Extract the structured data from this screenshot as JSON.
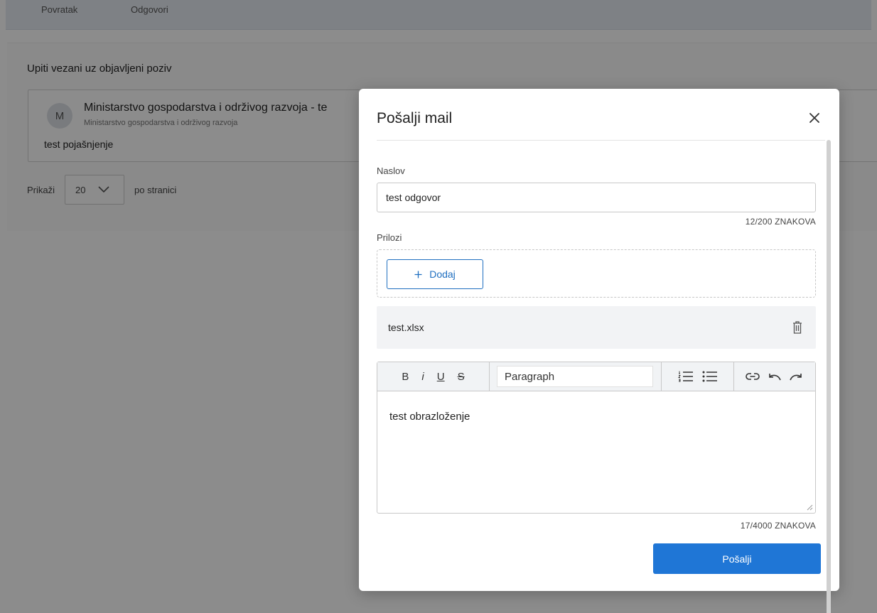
{
  "background": {
    "tabs": [
      "Povratak",
      "Odgovori"
    ],
    "section_title": "Upiti vezani uz objavljeni poziv",
    "query": {
      "avatar_letter": "M",
      "title": "Ministarstvo gospodarstva i održivog razvoja - te",
      "subtitle": "Ministarstvo gospodarstva i održivog razvoja",
      "text": "test pojašnjenje"
    },
    "pager": {
      "prefix": "Prikaži",
      "value": "20",
      "suffix": "po stranici"
    }
  },
  "modal": {
    "title": "Pošalji mail",
    "subject_label": "Naslov",
    "subject_value": "test odgovor",
    "subject_counter": "12/200 ZNAKOVA",
    "attachments_label": "Prilozi",
    "add_label": "Dodaj",
    "file_name": "test.xlsx",
    "editor": {
      "bold": "B",
      "italic": "i",
      "underline": "U",
      "strike": "S",
      "block_format": "Paragraph",
      "body": "test obrazloženje",
      "counter": "17/4000 ZNAKOVA"
    },
    "send_label": "Pošalji"
  },
  "colors": {
    "primary": "#1f76d6",
    "overlay": "rgba(0,0,0,0.45)"
  }
}
